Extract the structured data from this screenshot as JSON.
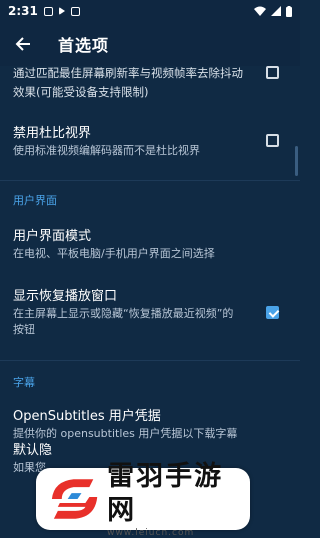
{
  "status": {
    "time": "2:31"
  },
  "appbar": {
    "title": "首选项"
  },
  "settings": [
    {
      "title": "",
      "subtitle": "通过匹配最佳屏幕刷新率与视频帧率去除抖动\n效果(可能受设备支持限制)",
      "checked": false
    },
    {
      "title": "禁用杜比视界",
      "subtitle": "使用标准视频编解码器而不是杜比视界",
      "checked": false
    },
    {
      "title": "用户界面模式",
      "subtitle": "在电视、平板电脑/手机用户界面之间选择"
    },
    {
      "title": "显示恢复播放窗口",
      "subtitle": "在主屏幕上显示或隐藏“恢复播放最近视频”的\n按钮",
      "checked": true
    },
    {
      "title": "OpenSubtitles 用户凭据",
      "subtitle": "提供你的 opensubtitles 用户凭据以下载字幕"
    },
    {
      "title": "默认隐",
      "subtitle": "如果您"
    }
  ],
  "sections": {
    "ui": "用户界面",
    "subtitles": "字幕"
  },
  "watermark": {
    "name": "雷羽手游网",
    "url": "www.leiucn.com"
  },
  "colors": {
    "background": "#102a44",
    "accent": "#4aa3e8"
  }
}
